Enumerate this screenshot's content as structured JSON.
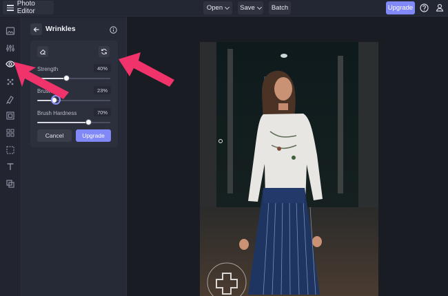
{
  "app": {
    "title": "Photo Editor"
  },
  "toolbar": {
    "open_label": "Open",
    "save_label": "Save",
    "batch_label": "Batch",
    "upgrade_label": "Upgrade"
  },
  "rail": {
    "icons": [
      "image-icon",
      "adjustments-icon",
      "eye-icon",
      "effects-icon",
      "artsy-icon",
      "frame-icon",
      "graphics-icon",
      "texture-icon",
      "text-icon",
      "overlay-icon"
    ]
  },
  "panel": {
    "title": "Wrinkles",
    "sliders": [
      {
        "label": "Strength",
        "value": "40%",
        "fraction": 0.4
      },
      {
        "label": "Brush Size",
        "value": "23%",
        "fraction": 0.23
      },
      {
        "label": "Brush Hardness",
        "value": "70%",
        "fraction": 0.7
      }
    ],
    "cancel_label": "Cancel",
    "upgrade_label": "Upgrade"
  },
  "colors": {
    "accent": "#8188f7",
    "annotation_arrow": "#f0336b",
    "background": "#1c1e27"
  }
}
